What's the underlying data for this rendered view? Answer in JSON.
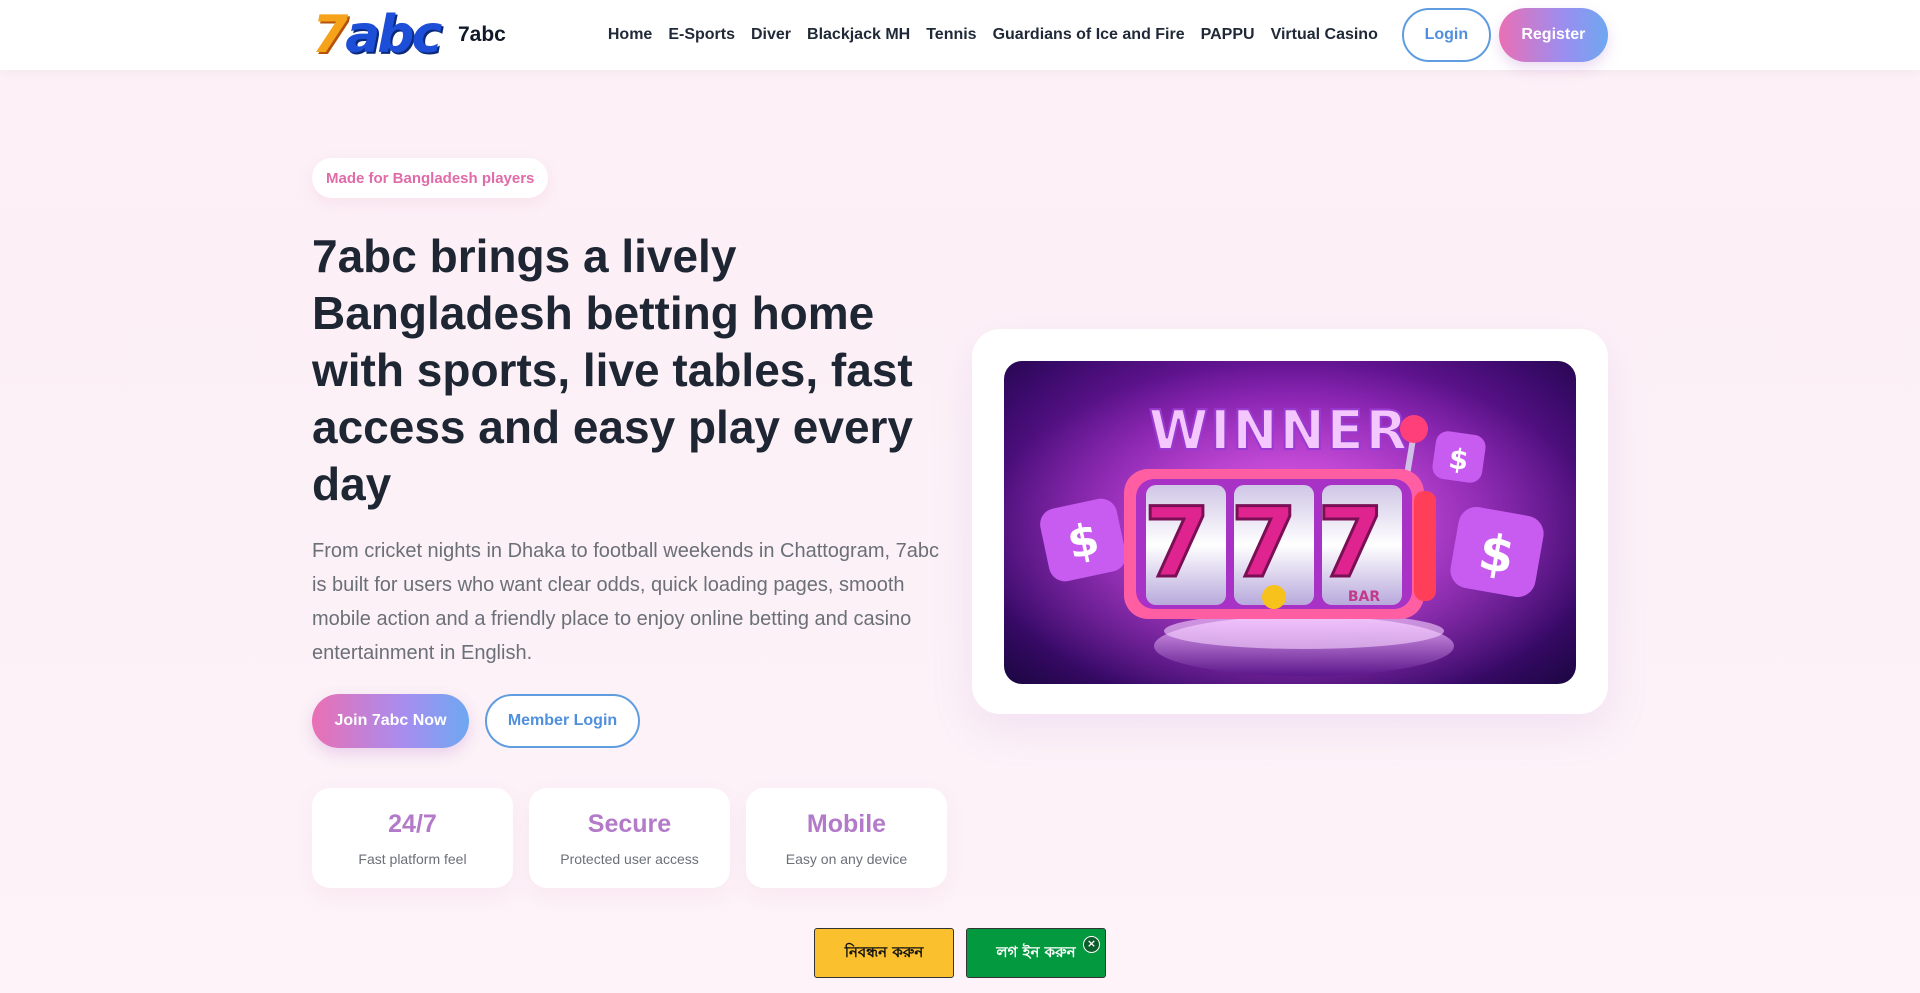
{
  "header": {
    "logo_mark": "7abc",
    "logo_text": "7abc",
    "nav": [
      {
        "label": "Home"
      },
      {
        "label": "E-Sports"
      },
      {
        "label": "Diver"
      },
      {
        "label": "Blackjack MH"
      },
      {
        "label": "Tennis"
      },
      {
        "label": "Guardians of Ice and Fire"
      },
      {
        "label": "PAPPU"
      },
      {
        "label": "Virtual Casino"
      }
    ],
    "login_label": "Login",
    "register_label": "Register"
  },
  "hero": {
    "pill": "Made for Bangladesh players",
    "title": "7abc brings a lively Bangladesh betting home with sports, live tables, fast access and easy play every day",
    "description": "From cricket nights in Dhaka to football weekends in Chattogram, 7abc is built for users who want clear odds, quick loading pages, smooth mobile action and a friendly place to enjoy online betting and casino entertainment in English.",
    "join_label": "Join 7abc Now",
    "member_login_label": "Member Login",
    "stats": [
      {
        "value": "24/7",
        "label": "Fast platform feel"
      },
      {
        "value": "Secure",
        "label": "Protected user access"
      },
      {
        "value": "Mobile",
        "label": "Easy on any device"
      }
    ],
    "image_text": "WINNER",
    "image_reels": "777",
    "image_bar": "BAR"
  },
  "bottom_cta": {
    "register_label": "নিবন্ধন করুন",
    "login_label": "লগ ইন করুন",
    "close_glyph": "×"
  },
  "colors": {
    "accent_pink": "#ea6fb4",
    "accent_blue": "#5f9de0",
    "stat_purple": "#b37ac9",
    "cta_yellow": "#fbc02d",
    "cta_green": "#03993f"
  }
}
